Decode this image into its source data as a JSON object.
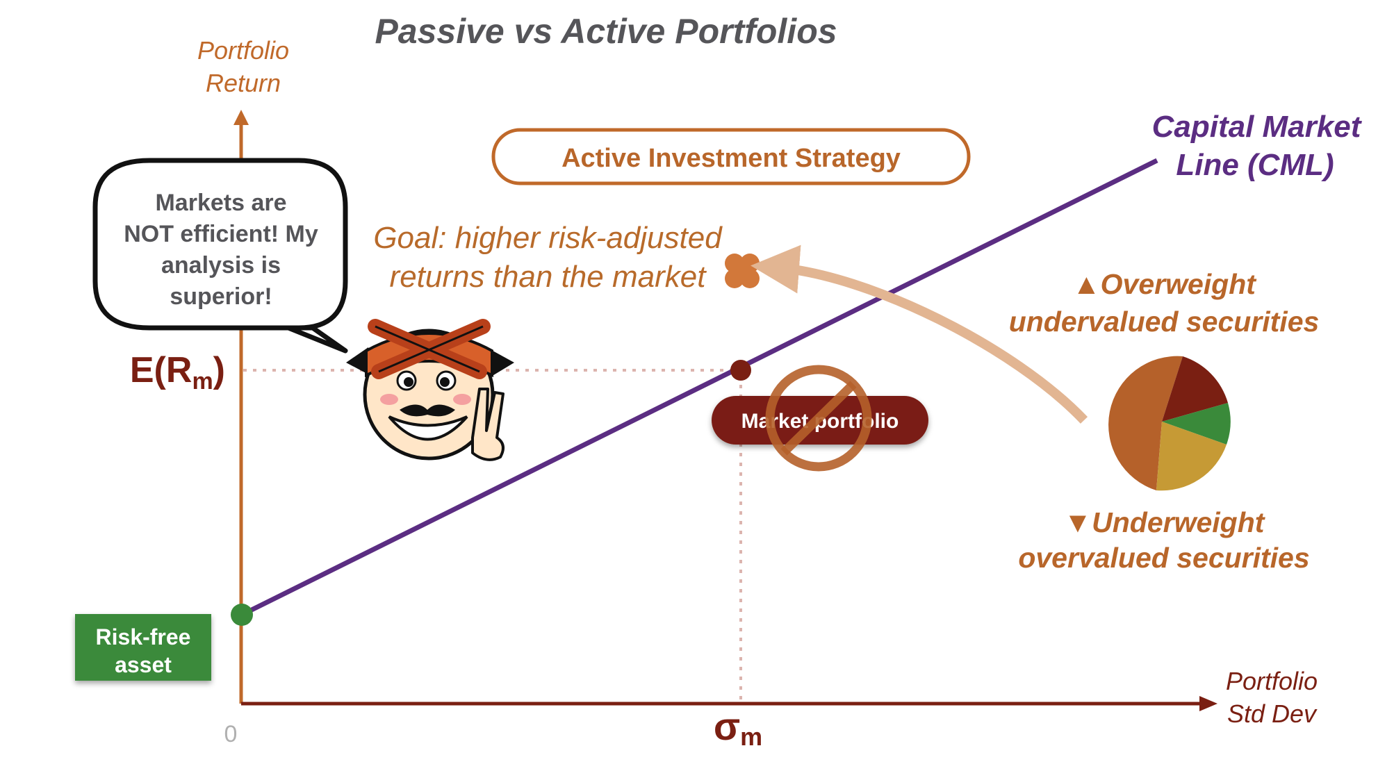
{
  "title": "Passive vs Active Portfolios",
  "y_axis": {
    "line1": "Portfolio",
    "line2": "Return"
  },
  "x_axis": {
    "line1": "Portfolio",
    "line2": "Std Dev"
  },
  "origin_label": "0",
  "er_label": {
    "main": "E(R",
    "sub": "m",
    "close": ")"
  },
  "sigma_label": {
    "main": "σ",
    "sub": "m"
  },
  "strategy_box": "Active Investment Strategy",
  "cml_label": {
    "line1": "Capital Market",
    "line2": "Line (CML)"
  },
  "speech_bubble": {
    "line1": "Markets are",
    "line2": "NOT efficient! My",
    "line3": "analysis is",
    "line4": "superior!"
  },
  "goal": {
    "line1": "Goal: higher risk-adjusted",
    "line2": "returns than the market"
  },
  "overweight": {
    "line1": "▲Overweight",
    "line2": "undervalued securities"
  },
  "underweight": {
    "line1": "▼Underweight",
    "line2": "overvalued securities"
  },
  "risk_free_box": {
    "line1": "Risk-free",
    "line2": "asset"
  },
  "market_portfolio": "Market portfolio",
  "colors": {
    "axis_orange": "#c0692a",
    "axis_dark": "#7a1f12",
    "cml_purple": "#5b2d82",
    "risk_free_green": "#3a8a3a",
    "market_red": "#7a1f12",
    "arrow_beige": "#e2b592"
  },
  "icons": [
    "cartoon-investor-icon",
    "no-sign-icon",
    "target-flower-icon",
    "pie-chart-icon"
  ]
}
